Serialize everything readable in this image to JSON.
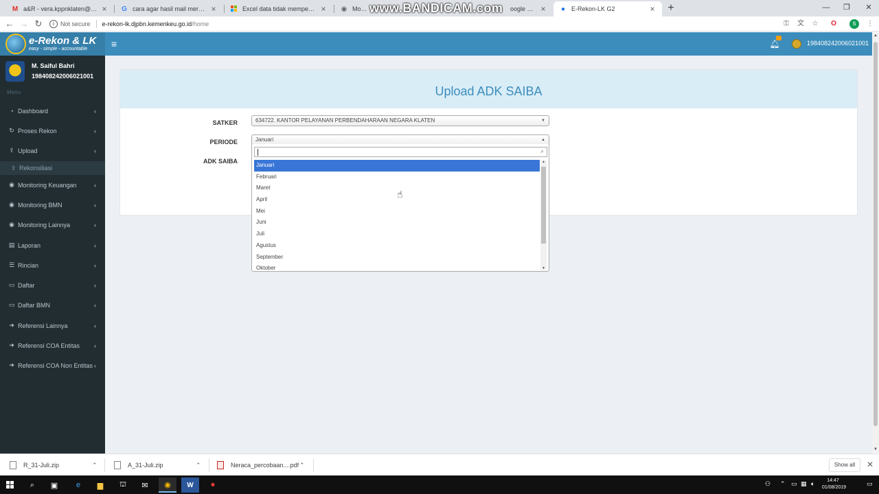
{
  "browser": {
    "tabs": [
      {
        "label": "a&R - vera.kppnklaten@gmail.com",
        "icon": "gmail-icon"
      },
      {
        "label": "cara agar hasil mail merge sama",
        "icon": "google-icon"
      },
      {
        "label": "Excel data tidak mempertahankan",
        "icon": "ms-icon"
      },
      {
        "label": "MonevPA",
        "icon": "page-icon"
      },
      {
        "label": "oogle Nggolo",
        "icon": "google-icon"
      },
      {
        "label": "E-Rekon-LK G2",
        "icon": "globe-icon"
      }
    ],
    "watermark": "www.BANDICAM.com",
    "security": "Not secure",
    "url_domain": "e-rekon-lk.djpbn.kemenkeu.go.id",
    "url_path": "/home",
    "profile_initial": "s"
  },
  "app": {
    "logo_title": "e-Rekon & LK",
    "logo_tagline": "easy - simple - accountable",
    "header_user": "198408242006021001",
    "notif_count": "",
    "colors": {
      "header": "#3c8dbc",
      "sidebar": "#222d32",
      "selected": "#3875d7"
    }
  },
  "sidebar": {
    "user_name": "M. Saiful Bahri",
    "user_nip": "198408242006021001",
    "menu_header": "Menu",
    "items": [
      {
        "label": "Dashboard",
        "icon": "dashboard-icon"
      },
      {
        "label": "Proses Rekon",
        "icon": "refresh-icon"
      },
      {
        "label": "Upload",
        "icon": "upload-icon"
      },
      {
        "label": "Monitoring Keuangan",
        "icon": "eye-icon"
      },
      {
        "label": "Monitoring BMN",
        "icon": "eye-icon"
      },
      {
        "label": "Monitoring Lainnya",
        "icon": "eye-icon"
      },
      {
        "label": "Laporan",
        "icon": "book-icon"
      },
      {
        "label": "Rincian",
        "icon": "list-icon"
      },
      {
        "label": "Daftar",
        "icon": "file-icon"
      },
      {
        "label": "Daftar BMN",
        "icon": "file-icon"
      },
      {
        "label": "Referensi Lainnya",
        "icon": "arrow-icon"
      },
      {
        "label": "Referensi COA Entitas",
        "icon": "arrow-icon"
      },
      {
        "label": "Referensi COA Non Entitas",
        "icon": "arrow-icon"
      }
    ],
    "submenu_item": "Rekonsiliasi"
  },
  "form": {
    "title": "Upload ADK SAIBA",
    "satker_label": "SATKER",
    "satker_value": "634722. KANTOR PELAYANAN PERBENDAHARAAN NEGARA KLATEN",
    "periode_label": "PERIODE",
    "periode_value": "Januari",
    "adk_label": "ADK SAIBA",
    "months": [
      "Januari",
      "Februari",
      "Maret",
      "April",
      "Mei",
      "Juni",
      "Juli",
      "Agustus",
      "September",
      "Oktober"
    ]
  },
  "downloads": {
    "items": [
      "R_31-Juli.zip",
      "A_31-Juli.zip",
      "Neraca_percobaan....pdf"
    ],
    "show_all": "Show all"
  },
  "taskbar": {
    "time": "14:47",
    "date": "01/08/2019"
  }
}
